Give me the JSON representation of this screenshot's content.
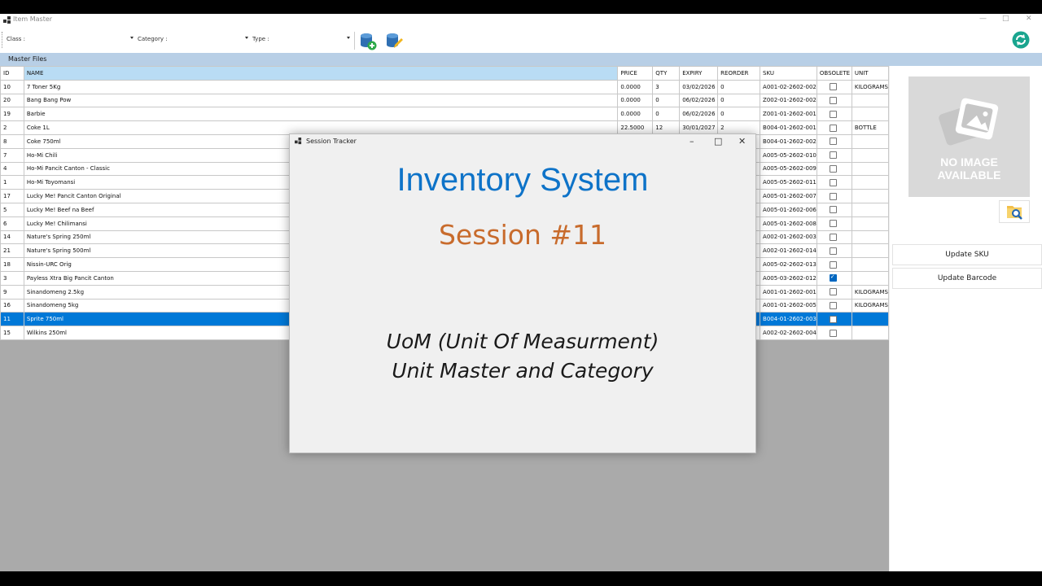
{
  "window": {
    "title": "Item Master"
  },
  "filters": {
    "class_label": "Class :",
    "category_label": "Category :",
    "type_label": "Type :"
  },
  "section": {
    "label": "Master Files"
  },
  "grid": {
    "columns": [
      "ID",
      "NAME",
      "PRICE",
      "QTY",
      "EXPIRY",
      "REORDER",
      "SKU",
      "OBSOLETE",
      "UNIT"
    ],
    "rows": [
      {
        "id": "10",
        "name": "7 Toner 5Kg",
        "price": "0.0000",
        "qty": "3",
        "expiry": "03/02/2026",
        "reorder": "0",
        "sku": "A001-02-2602-002",
        "obsolete": false,
        "unit": "KILOGRAMS"
      },
      {
        "id": "20",
        "name": "Bang Bang Pow",
        "price": "0.0000",
        "qty": "0",
        "expiry": "06/02/2026",
        "reorder": "0",
        "sku": "Z002-01-2602-002",
        "obsolete": false,
        "unit": ""
      },
      {
        "id": "19",
        "name": "Barbie",
        "price": "0.0000",
        "qty": "0",
        "expiry": "06/02/2026",
        "reorder": "0",
        "sku": "Z001-01-2602-001",
        "obsolete": false,
        "unit": ""
      },
      {
        "id": "2",
        "name": "Coke 1L",
        "price": "22.5000",
        "qty": "12",
        "expiry": "30/01/2027",
        "reorder": "2",
        "sku": "B004-01-2602-001",
        "obsolete": false,
        "unit": "BOTTLE"
      },
      {
        "id": "8",
        "name": "Coke 750ml",
        "price": "",
        "qty": "",
        "expiry": "",
        "reorder": "",
        "sku": "B004-01-2602-002",
        "obsolete": false,
        "unit": ""
      },
      {
        "id": "7",
        "name": "Ho-Mi Chili",
        "price": "",
        "qty": "",
        "expiry": "",
        "reorder": "",
        "sku": "A005-05-2602-010",
        "obsolete": false,
        "unit": ""
      },
      {
        "id": "4",
        "name": "Ho-Mi Pancit Canton - Classic",
        "price": "",
        "qty": "",
        "expiry": "",
        "reorder": "",
        "sku": "A005-05-2602-009",
        "obsolete": false,
        "unit": ""
      },
      {
        "id": "1",
        "name": "Ho-Mi Toyomansi",
        "price": "",
        "qty": "",
        "expiry": "",
        "reorder": "",
        "sku": "A005-05-2602-011",
        "obsolete": false,
        "unit": ""
      },
      {
        "id": "17",
        "name": "Lucky Me! Pancit Canton Original",
        "price": "",
        "qty": "",
        "expiry": "",
        "reorder": "",
        "sku": "A005-01-2602-007",
        "obsolete": false,
        "unit": ""
      },
      {
        "id": "5",
        "name": "Lucky Me! Beef na Beef",
        "price": "",
        "qty": "",
        "expiry": "",
        "reorder": "",
        "sku": "A005-01-2602-006",
        "obsolete": false,
        "unit": ""
      },
      {
        "id": "6",
        "name": "Lucky Me! Chilimansi",
        "price": "",
        "qty": "",
        "expiry": "",
        "reorder": "",
        "sku": "A005-01-2602-008",
        "obsolete": false,
        "unit": ""
      },
      {
        "id": "14",
        "name": "Nature's Spring 250ml",
        "price": "",
        "qty": "",
        "expiry": "",
        "reorder": "",
        "sku": "A002-01-2602-003",
        "obsolete": false,
        "unit": ""
      },
      {
        "id": "21",
        "name": "Nature's Spring 500ml",
        "price": "",
        "qty": "",
        "expiry": "",
        "reorder": "",
        "sku": "A002-01-2602-014",
        "obsolete": false,
        "unit": ""
      },
      {
        "id": "18",
        "name": "Nissin-URC Orig",
        "price": "",
        "qty": "",
        "expiry": "",
        "reorder": "",
        "sku": "A005-02-2602-013",
        "obsolete": false,
        "unit": ""
      },
      {
        "id": "3",
        "name": "Payless Xtra Big Pancit Canton",
        "price": "",
        "qty": "",
        "expiry": "",
        "reorder": "",
        "sku": "A005-03-2602-012",
        "obsolete": true,
        "unit": ""
      },
      {
        "id": "9",
        "name": "Sinandomeng 2.5kg",
        "price": "",
        "qty": "",
        "expiry": "",
        "reorder": "",
        "sku": "A001-01-2602-001",
        "obsolete": false,
        "unit": "KILOGRAMS"
      },
      {
        "id": "16",
        "name": "Sinandomeng 5kg",
        "price": "",
        "qty": "",
        "expiry": "",
        "reorder": "",
        "sku": "A001-01-2602-005",
        "obsolete": false,
        "unit": "KILOGRAMS"
      },
      {
        "id": "11",
        "name": "Sprite 750ml",
        "price": "",
        "qty": "",
        "expiry": "",
        "reorder": "",
        "sku": "B004-01-2602-003",
        "obsolete": false,
        "unit": "",
        "selected": true
      },
      {
        "id": "15",
        "name": "Wilkins 250ml",
        "price": "",
        "qty": "",
        "expiry": "",
        "reorder": "",
        "sku": "A002-02-2602-004",
        "obsolete": false,
        "unit": ""
      }
    ]
  },
  "side": {
    "no_image_line1": "NO IMAGE",
    "no_image_line2": "AVAILABLE",
    "update_sku": "Update SKU",
    "update_barcode": "Update Barcode"
  },
  "dialog": {
    "title": "Session Tracker",
    "heading": "Inventory System",
    "session": "Session #11",
    "topic_line1": "UoM (Unit Of Measurment)",
    "topic_line2": "Unit Master and Category"
  },
  "colors": {
    "accent": "#0e73c8",
    "session": "#c86b2c",
    "selected_row": "#0078d7",
    "section_bar": "#b8cfe6"
  }
}
